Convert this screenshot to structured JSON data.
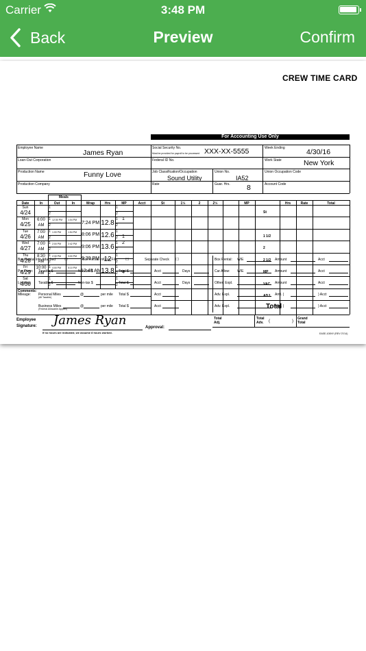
{
  "status_bar": {
    "carrier": "Carrier",
    "time": "3:48 PM",
    "wifi_icon": "wifi-icon",
    "battery_icon": "battery-icon"
  },
  "nav": {
    "back_label": "Back",
    "title": "Preview",
    "confirm_label": "Confirm",
    "back_icon": "chevron-left-icon",
    "color": "#4cae4f"
  },
  "card": {
    "title": "CREW TIME CARD",
    "labels": {
      "employee_name": "Employee Name",
      "ssn": "Social Security No.",
      "ssn_note": "Must be provided for payroll to be processed",
      "week_ending": "Week Ending",
      "loan_out": "Loan-Out Corporation",
      "federal_id": "Federal ID No.",
      "work_state": "Work State",
      "production_name": "Production Name",
      "job_class": "Job Classification/Occupation",
      "union_no": "Union No.",
      "union_occ": "Union Occupation Code",
      "production_company": "Production Company",
      "rate": "Rate",
      "guar_hrs": "Guar. Hrs.",
      "account_code": "Account Code",
      "meals": "Meals",
      "accounting_header": "For Accounting Use Only"
    },
    "values": {
      "employee_name": "James Ryan",
      "ssn": "XXX-XX-5555",
      "week_ending": "4/30/16",
      "work_state": "New York",
      "production_name": "Funny Love",
      "job_class": "Sound Utility",
      "union_no": "IA52",
      "guar_hrs": "8"
    },
    "columns": [
      "Date",
      "In",
      "Out",
      "In",
      "Wrap",
      "Hrs",
      "MP",
      "Acct",
      "St",
      "1½",
      "2",
      "2½",
      "",
      "MP",
      "",
      "Hrs",
      "Rate",
      "Total"
    ],
    "days": [
      {
        "day": "Sun",
        "date": "4/24",
        "in": "",
        "out": "",
        "in2": "",
        "wrap": "",
        "hrs": "",
        "mp": "",
        "mp_note": ""
      },
      {
        "day": "Mon",
        "date": "4/25",
        "in": "6:00",
        "ampm": "AM",
        "out": "12:30 PM",
        "in2": "1:04 PM",
        "wrap": "7:24 PM",
        "hrs": "12.8",
        "mp": "1",
        "mp_note": ""
      },
      {
        "day": "Tue",
        "date": "4/26",
        "in": "7:00",
        "ampm": "AM",
        "out": "1:00 PM",
        "in2": "1:54 PM",
        "wrap": "8:06 PM",
        "hrs": "12.6",
        "mp": "",
        "mp_note": "1"
      },
      {
        "day": "Wed",
        "date": "4/27",
        "in": "7:00",
        "ampm": "AM",
        "out": "2:00 PM",
        "in2": "2:42 PM",
        "wrap": "9:06 PM",
        "hrs": "13.6",
        "mp": "2",
        "mp_note": ""
      },
      {
        "day": "Thu",
        "date": "4/28",
        "in": "8:30",
        "ampm": "AM",
        "out": "2:30 PM",
        "in2": "3:00 PM",
        "wrap": "9:30 PM",
        "hrs": "12",
        "mp": "",
        "mp_note": ""
      },
      {
        "day": "Fri",
        "date": "4/29",
        "in": "10:00",
        "ampm": "AM",
        "out": "4:00 PM",
        "in2": "5:10 PM",
        "wrap": "12:48 AM",
        "hrs": "13.8",
        "mp": "",
        "mp_note": "4"
      },
      {
        "day": "Sat",
        "date": "4/30",
        "in": "",
        "out": "",
        "in2": "",
        "wrap": "",
        "hrs": "",
        "mp": "",
        "mp_note": ""
      }
    ],
    "acct_rows": [
      "St",
      "1 1/2",
      "2",
      "2 1/2",
      "MP",
      "VAC",
      "ADJ"
    ],
    "comments_label": "Comments:",
    "total_label": "Total",
    "box_rental": {
      "attached": "Box Rental Info Attached",
      "on_file": "Box Rental Info on File",
      "separate": "Separate Check"
    },
    "expense_rows": [
      {
        "label": "Per Diem:",
        "a": "Taxable $",
        "b": "Non-tax $",
        "c": "Total $",
        "d": "Acct",
        "e": "Days"
      },
      {
        "label": "Lodging:",
        "a": "Taxable $",
        "b": "Non-tax $",
        "c": "Total $",
        "d": "Acct",
        "e": "Days"
      },
      {
        "label": "Mileage:",
        "a": "Personal Miles",
        "a2": "(All Taxable)",
        "b": "@",
        "b2": "per mile",
        "c": "Total $",
        "d": "Acct"
      },
      {
        "label": "",
        "a": "Business Miles",
        "a2": "(Federal Allowable Applies)",
        "b": "@",
        "b2": "per mile",
        "c": "Total $",
        "d": "Acct"
      }
    ],
    "right_rows": [
      {
        "label": "Box Rental:",
        "a": "W/E",
        "b": "Amount",
        "c": "Acct"
      },
      {
        "label": "Car Allow:",
        "a": "W/E",
        "b": "Amount",
        "c": "Acct"
      },
      {
        "label": "Other: Expl.",
        "a": "",
        "b": "Amount",
        "c": "Acct"
      },
      {
        "label": "Adv. Expl.",
        "a": "",
        "b": "Amt. (",
        "c": ") Acct"
      },
      {
        "label": "Adv. Expl.",
        "a": "",
        "b": "Amt. (",
        "c": ") Acct"
      }
    ],
    "employee_signature": "Employee\nSignature:",
    "signature_text": "James Ryan",
    "approval": "Approval:",
    "footnote": "If no hours are indicated, we assume 8 hours worked.",
    "total_adj": "Total\nAdj.",
    "total_adv": "Total\nAdv.",
    "grand_total": "Grand\nTotal",
    "form_code": "EASE-100NY (REV 07/14)"
  }
}
